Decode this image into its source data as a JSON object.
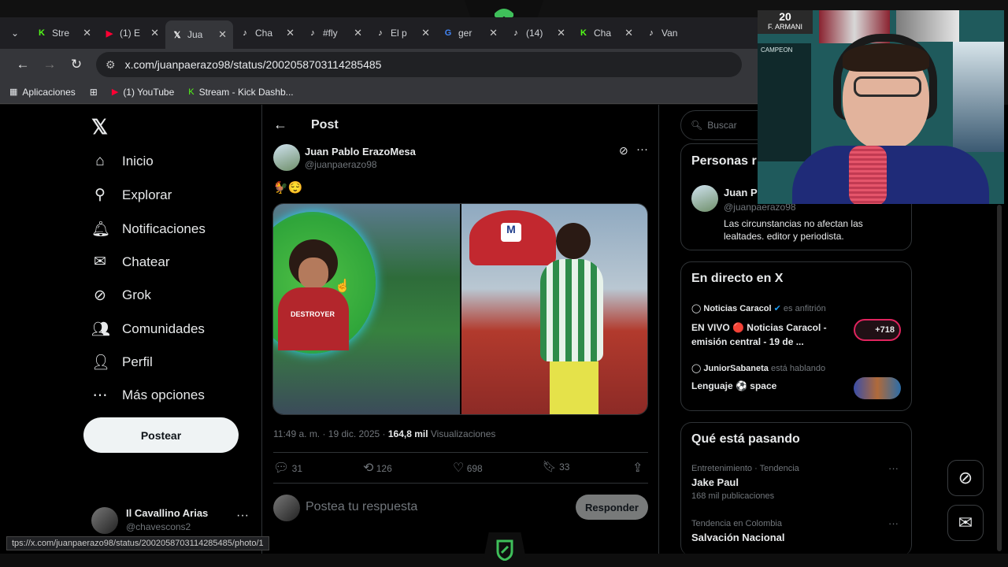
{
  "tabs": [
    {
      "icon": "kick-icon",
      "label": "Stre",
      "color": "#53fc18",
      "active": false
    },
    {
      "icon": "youtube-icon",
      "label": "(1) E",
      "color": "#ff0033",
      "active": false
    },
    {
      "icon": "x-icon",
      "label": "Jua",
      "color": "#ffffff",
      "active": true
    },
    {
      "icon": "tiktok-icon",
      "label": "Cha",
      "color": "#ffffff",
      "active": false
    },
    {
      "icon": "tiktok-icon",
      "label": "#fly",
      "color": "#ffffff",
      "active": false
    },
    {
      "icon": "tiktok-icon",
      "label": "El p",
      "color": "#ffffff",
      "active": false
    },
    {
      "icon": "google-icon",
      "label": "ger",
      "color": "#4285f4",
      "active": false
    },
    {
      "icon": "tiktok-icon",
      "label": "(14)",
      "color": "#ffffff",
      "active": false
    },
    {
      "icon": "kick-icon",
      "label": "Cha",
      "color": "#53fc18",
      "active": false
    },
    {
      "icon": "tiktok-icon",
      "label": "Van",
      "color": "#ffffff",
      "active": false
    }
  ],
  "browser": {
    "url": "x.com/juanpaerazo98/status/2002058703114285485",
    "bookmarks": [
      {
        "icon": "apps-grid-icon",
        "label": "Aplicaciones"
      },
      {
        "icon": "youtube-icon",
        "label": "(1) YouTube"
      },
      {
        "icon": "kick-icon",
        "label": "Stream - Kick Dashb..."
      }
    ],
    "status_url": "tps://x.com/juanpaerazo98/status/2002058703114285485/photo/1"
  },
  "sidebar": {
    "items": [
      {
        "icon": "home-icon",
        "label": "Inicio"
      },
      {
        "icon": "search-icon",
        "label": "Explorar"
      },
      {
        "icon": "bell-icon",
        "label": "Notificaciones"
      },
      {
        "icon": "mail-icon",
        "label": "Chatear"
      },
      {
        "icon": "grok-icon",
        "label": "Grok"
      },
      {
        "icon": "communities-icon",
        "label": "Comunidades"
      },
      {
        "icon": "person-icon",
        "label": "Perfil"
      },
      {
        "icon": "more-icon",
        "label": "Más opciones"
      }
    ],
    "post_label": "Postear",
    "account_name": "Il Cavallino Arias",
    "account_handle": "@chavescons2"
  },
  "post": {
    "header": "Post",
    "author": "Juan Pablo ErazoMesa",
    "handle": "@juanpaerazo98",
    "text": "🐓😌",
    "timestamp": "11:49 a. m. · 19 dic. 2025 · ",
    "views": "164,8 mil",
    "views_label": " Visualizaciones",
    "replies": "31",
    "reposts": "126",
    "likes": "698",
    "bookmarks": "33",
    "reply_placeholder": "Postea tu respuesta",
    "reply_button": "Responder",
    "image_logo": "M",
    "shirt_text": "DESTROYER"
  },
  "right": {
    "search_placeholder": "Buscar",
    "people_title": "Personas r",
    "person_name": "Juan Pa",
    "person_handle": "@juanpaerazo98",
    "person_bio": "Las circunstancias no afectan las lealtades. editor y periodista.",
    "live_title": "En directo en X",
    "live1_host": "Noticias Caracol",
    "live1_role": "es anfitrión",
    "live1_title": "EN VIVO 🔴 Noticias Caracol - emisión central - 19 de ...",
    "live1_count": "+718",
    "live2_host": "JuniorSabaneta",
    "live2_role": "está hablando",
    "live2_title": "Lenguaje ⚽ space",
    "trending_title": "Qué está pasando",
    "trend1_meta": "Entretenimiento · Tendencia",
    "trend1_name": "Jake Paul",
    "trend1_count": "168 mil publicaciones",
    "trend2_meta": "Tendencia en Colombia",
    "trend2_name": "Salvación Nacional"
  },
  "webcam": {
    "badge_number": "20",
    "badge_name": "F. ARMANI",
    "board_title": "CAMPEON"
  }
}
